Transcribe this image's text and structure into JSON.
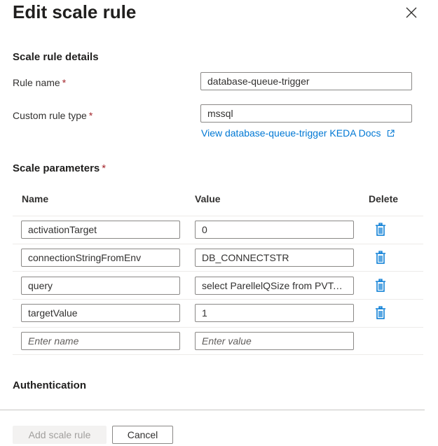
{
  "panel": {
    "title": "Edit scale rule"
  },
  "details": {
    "section_title": "Scale rule details",
    "rule_name_label": "Rule name",
    "rule_name_value": "database-queue-trigger",
    "custom_type_label": "Custom rule type",
    "custom_type_value": "mssql",
    "docs_link": "View database-queue-trigger KEDA Docs",
    "required_marker": "*"
  },
  "parameters": {
    "section_title": "Scale parameters",
    "columns": {
      "name": "Name",
      "value": "Value",
      "delete": "Delete"
    },
    "rows": [
      {
        "name": "activationTarget",
        "value": "0"
      },
      {
        "name": "connectionStringFromEnv",
        "value": "DB_CONNECTSTR"
      },
      {
        "name": "query",
        "value": "select ParellelQSize from PVTas..."
      },
      {
        "name": "targetValue",
        "value": "1"
      }
    ],
    "new_row": {
      "name_placeholder": "Enter name",
      "value_placeholder": "Enter value"
    }
  },
  "auth": {
    "section_title": "Authentication"
  },
  "footer": {
    "add_label": "Add scale rule",
    "cancel_label": "Cancel"
  },
  "colors": {
    "accent": "#0078d4",
    "required": "#a4262c",
    "border": "#8a8886"
  },
  "icons": {
    "close": "close-icon",
    "delete": "trash-icon",
    "external": "external-link-icon"
  }
}
